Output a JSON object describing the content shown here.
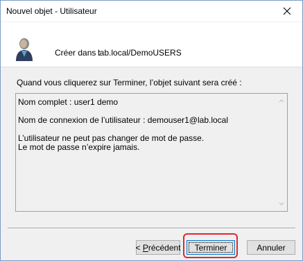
{
  "window": {
    "title": "Nouvel objet - Utilisateur"
  },
  "header": {
    "create_label": "Créer dans :",
    "create_value": "lab.local/DemoUSERS"
  },
  "summary": {
    "intro": "Quand vous cliquerez sur Terminer, l’objet suivant sera créé :",
    "text": "Nom complet : user1 demo\n\nNom de connexion de l’utilisateur : demouser1@lab.local\n\nL’utilisateur ne peut pas changer de mot de passe.\nLe mot de passe n’expire jamais."
  },
  "buttons": {
    "prev_prefix": "< ",
    "prev_mnemonic": "P",
    "prev_rest": "récédent",
    "finish": "Terminer",
    "cancel": "Annuler"
  },
  "colors": {
    "highlight": "#e5262c",
    "focus_border": "#0078d7"
  }
}
